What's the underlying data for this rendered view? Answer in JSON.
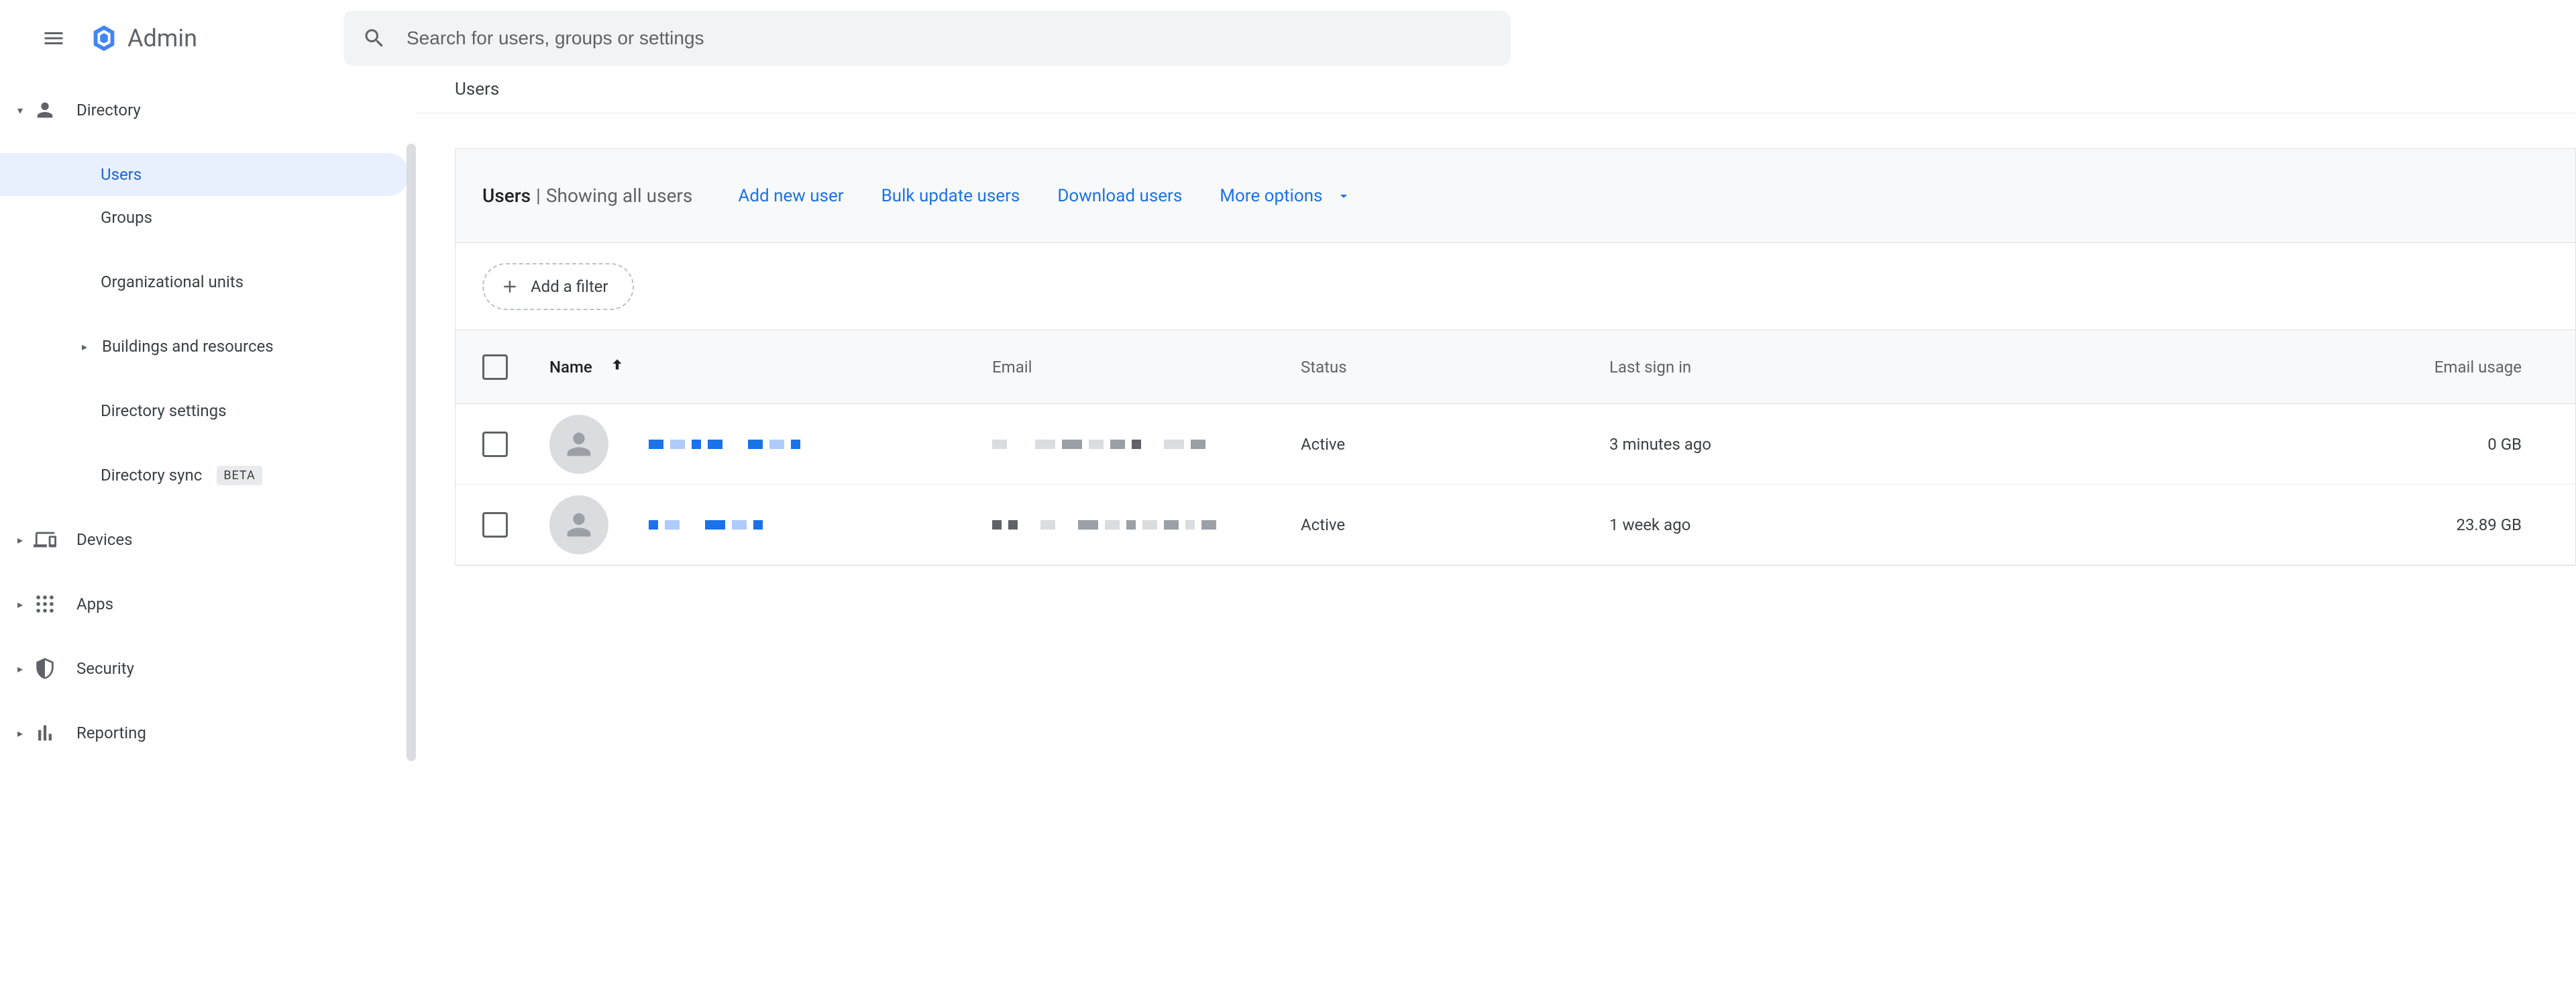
{
  "brand": {
    "name": "Admin"
  },
  "search": {
    "placeholder": "Search for users, groups or settings"
  },
  "sidebar": {
    "directory": {
      "label": "Directory",
      "users": "Users",
      "groups": "Groups",
      "org_units": "Organizational units",
      "buildings": "Buildings and resources",
      "dir_settings": "Directory settings",
      "dir_sync": "Directory sync",
      "dir_sync_badge": "BETA"
    },
    "devices": "Devices",
    "apps": "Apps",
    "security": "Security",
    "reporting": "Reporting"
  },
  "breadcrumb": "Users",
  "card": {
    "title": "Users",
    "subtitle": "Showing all users",
    "actions": {
      "add": "Add new user",
      "bulk": "Bulk update users",
      "download": "Download users",
      "more": "More options"
    },
    "filter_chip": "Add a filter"
  },
  "table": {
    "headers": {
      "name": "Name",
      "email": "Email",
      "status": "Status",
      "last_sign_in": "Last sign in",
      "email_usage": "Email usage"
    },
    "sort_column": "name",
    "sort_direction": "asc",
    "rows": [
      {
        "status": "Active",
        "last_sign_in": "3 minutes ago",
        "email_usage": "0 GB"
      },
      {
        "status": "Active",
        "last_sign_in": "1 week ago",
        "email_usage": "23.89 GB"
      }
    ]
  }
}
